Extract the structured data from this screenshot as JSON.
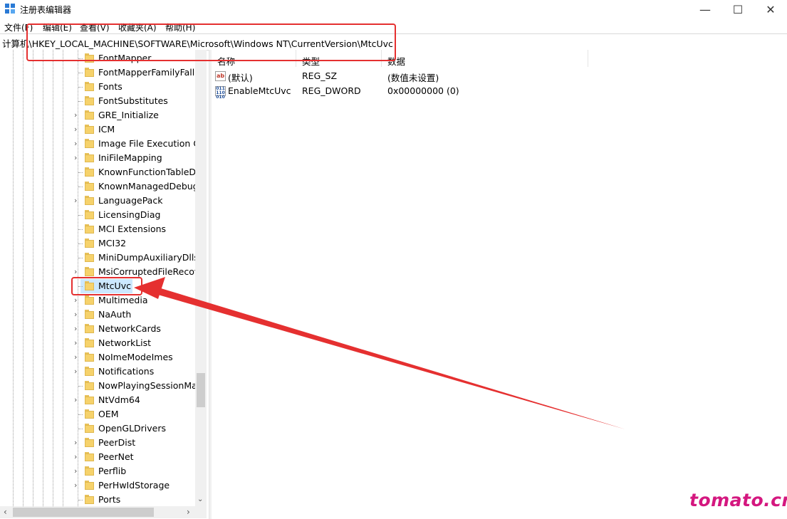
{
  "window": {
    "title": "注册表编辑器",
    "controls": [
      "—",
      "☐",
      "✕"
    ]
  },
  "menu": [
    "文件(F)",
    "编辑(E)",
    "查看(V)",
    "收藏夹(A)",
    "帮助(H)"
  ],
  "address": "计算机\\HKEY_LOCAL_MACHINE\\SOFTWARE\\Microsoft\\Windows NT\\CurrentVersion\\MtcUvc",
  "tree": {
    "items": [
      {
        "label": "FontMapper",
        "expandable": false
      },
      {
        "label": "FontMapperFamilyFallb",
        "expandable": false
      },
      {
        "label": "Fonts",
        "expandable": false
      },
      {
        "label": "FontSubstitutes",
        "expandable": false
      },
      {
        "label": "GRE_Initialize",
        "expandable": true
      },
      {
        "label": "ICM",
        "expandable": true
      },
      {
        "label": "Image File Execution O",
        "expandable": true
      },
      {
        "label": "IniFileMapping",
        "expandable": true
      },
      {
        "label": "KnownFunctionTableDll",
        "expandable": false
      },
      {
        "label": "KnownManagedDebugg",
        "expandable": false
      },
      {
        "label": "LanguagePack",
        "expandable": true
      },
      {
        "label": "LicensingDiag",
        "expandable": false
      },
      {
        "label": "MCI Extensions",
        "expandable": false
      },
      {
        "label": "MCI32",
        "expandable": false
      },
      {
        "label": "MiniDumpAuxiliaryDlls",
        "expandable": false
      },
      {
        "label": "MsiCorruptedFileRecov",
        "expandable": true
      },
      {
        "label": "MtcUvc",
        "expandable": false,
        "selected": true
      },
      {
        "label": "Multimedia",
        "expandable": true
      },
      {
        "label": "NaAuth",
        "expandable": true
      },
      {
        "label": "NetworkCards",
        "expandable": true
      },
      {
        "label": "NetworkList",
        "expandable": true
      },
      {
        "label": "NoImeModeImes",
        "expandable": true
      },
      {
        "label": "Notifications",
        "expandable": true
      },
      {
        "label": "NowPlayingSessionMan",
        "expandable": false
      },
      {
        "label": "NtVdm64",
        "expandable": true
      },
      {
        "label": "OEM",
        "expandable": false
      },
      {
        "label": "OpenGLDrivers",
        "expandable": false
      },
      {
        "label": "PeerDist",
        "expandable": true
      },
      {
        "label": "PeerNet",
        "expandable": true
      },
      {
        "label": "Perflib",
        "expandable": true
      },
      {
        "label": "PerHwIdStorage",
        "expandable": true
      },
      {
        "label": "Ports",
        "expandable": false
      }
    ]
  },
  "values": {
    "columns": [
      "名称",
      "类型",
      "数据"
    ],
    "rows": [
      {
        "icon": "string-value-icon",
        "name": "(默认)",
        "type": "REG_SZ",
        "data": "(数值未设置)"
      },
      {
        "icon": "binary-value-icon",
        "name": "EnableMtcUvc",
        "type": "REG_DWORD",
        "data": "0x00000000 (0)"
      }
    ]
  },
  "watermark": "tomato.cm",
  "colors": {
    "annotation": "#e53030",
    "selection": "#cce8ff",
    "watermark": "#d4177f"
  }
}
